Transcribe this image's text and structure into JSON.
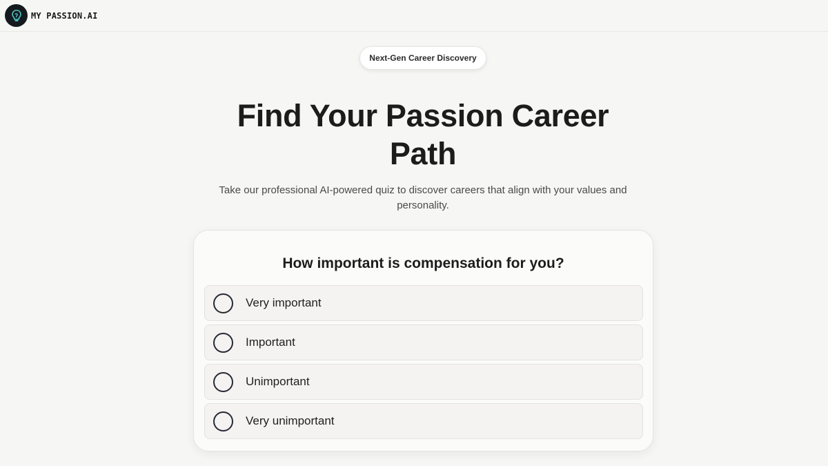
{
  "header": {
    "logo_icon": "lightbulb-icon",
    "brand_name": "MY PASSION.AI"
  },
  "hero": {
    "badge": "Next-Gen Career Discovery",
    "title": "Find Your Passion Career Path",
    "subtitle": "Take our professional AI-powered quiz to discover careers that align with your values and personality."
  },
  "quiz": {
    "question": "How important is compensation for you?",
    "options": [
      {
        "label": "Very important",
        "selected": false
      },
      {
        "label": "Important",
        "selected": false
      },
      {
        "label": "Unimportant",
        "selected": false
      },
      {
        "label": "Very unimportant",
        "selected": false
      }
    ]
  },
  "colors": {
    "background": "#f6f6f5",
    "logo_bg": "#151a1e",
    "logo_accent": "#4fc3c7",
    "text": "#1c1c1c",
    "radio_border": "#262a33"
  }
}
